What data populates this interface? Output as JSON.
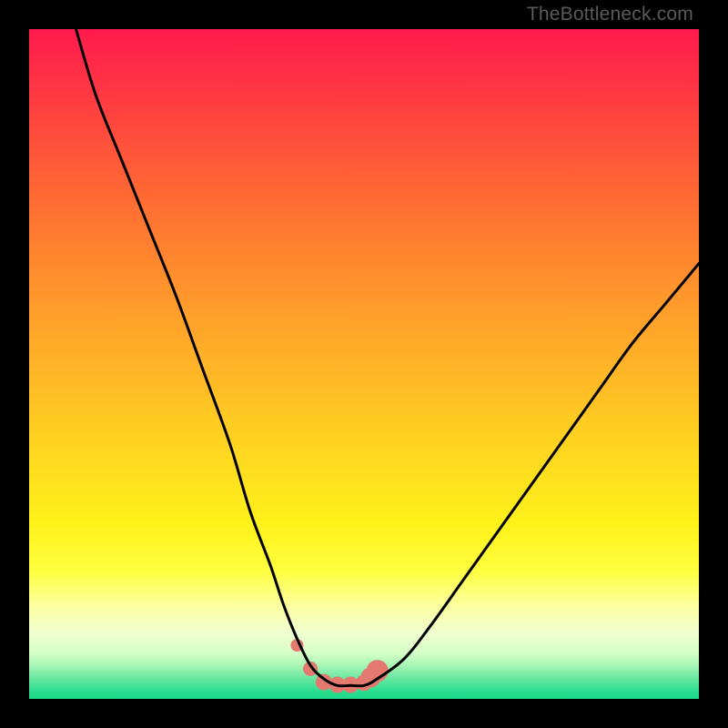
{
  "watermark": "TheBottleneck.com",
  "colors": {
    "frame": "#000000",
    "marker": "#e4796f",
    "line": "#000000"
  },
  "chart_data": {
    "type": "line",
    "title": "",
    "xlabel": "",
    "ylabel": "",
    "xlim": [
      0,
      100
    ],
    "ylim": [
      0,
      100
    ],
    "grid": false,
    "legend": false,
    "series": [
      {
        "name": "bottleneck-curve",
        "x": [
          7,
          10,
          14,
          18,
          22,
          26,
          30,
          33,
          36,
          38,
          40,
          42,
          44,
          46,
          48,
          50,
          52,
          56,
          60,
          65,
          70,
          75,
          80,
          85,
          90,
          95,
          100
        ],
        "y": [
          100,
          90,
          80,
          70,
          60,
          49,
          38,
          28,
          20,
          14,
          9,
          5,
          3,
          2,
          2,
          2,
          3,
          6,
          11,
          18,
          25,
          32,
          39,
          46,
          53,
          59,
          65
        ]
      }
    ],
    "markers": {
      "name": "optimal-range-markers",
      "x": [
        40,
        42,
        44,
        46,
        48,
        50,
        51,
        52
      ],
      "y": [
        8,
        4.5,
        2.5,
        2.1,
        2.1,
        2.4,
        3.2,
        4.2
      ],
      "size": [
        7,
        8,
        9,
        9,
        9,
        9,
        11,
        12
      ]
    }
  }
}
